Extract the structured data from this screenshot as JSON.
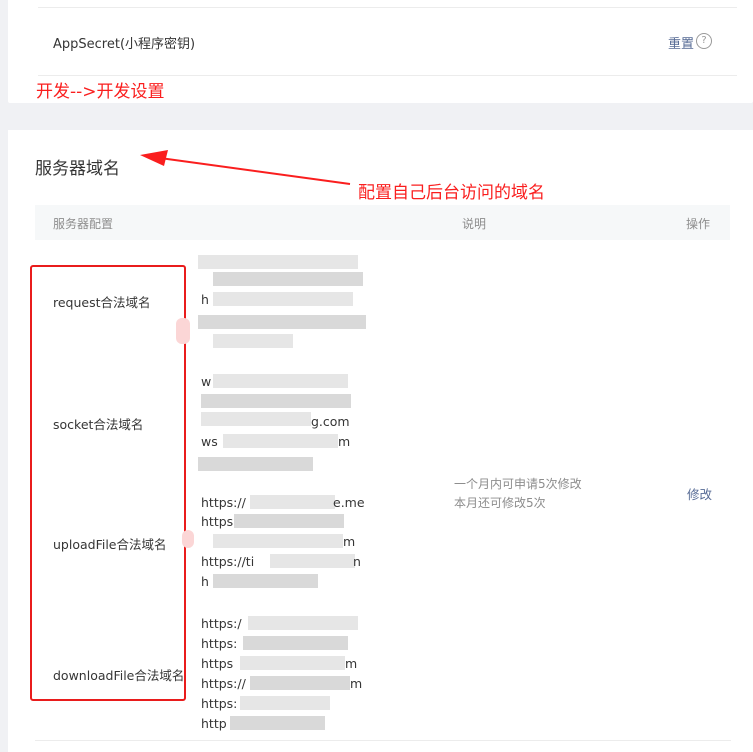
{
  "app_secret": {
    "label": "AppSecret(小程序密钥)",
    "reset_label": "重置",
    "help_icon": "question-circle-icon"
  },
  "annotations": {
    "dev_path": "开发-->开发设置",
    "config_hint": "配置自己后台访问的域名",
    "color": "#fa1e1e"
  },
  "server_domain": {
    "title": "服务器域名",
    "columns": {
      "config": "服务器配置",
      "desc": "说明",
      "ops": "操作"
    },
    "rows": [
      {
        "label": "request合法域名",
        "urls": [
          "h",
          "",
          "",
          ""
        ]
      },
      {
        "label": "socket合法域名",
        "urls": [
          "w",
          "",
          "g.com",
          "ws"
        ]
      },
      {
        "label": "uploadFile合法域名",
        "urls": [
          "https://",
          "https",
          "",
          "https://ti",
          "h"
        ]
      },
      {
        "label": "downloadFile合法域名",
        "urls": [
          "https:/",
          "https:",
          "https",
          "https://",
          "https:",
          "http"
        ]
      }
    ],
    "url_suffixes": {
      "socket_4": "m",
      "upload_1": "e.me",
      "upload_3": "m",
      "upload_4": "n",
      "download_3": "m",
      "download_4": "m"
    },
    "desc_lines": [
      "一个月内可申请5次修改",
      "本月还可修改5次"
    ],
    "modify_label": "修改",
    "link_color": "#576b95"
  }
}
